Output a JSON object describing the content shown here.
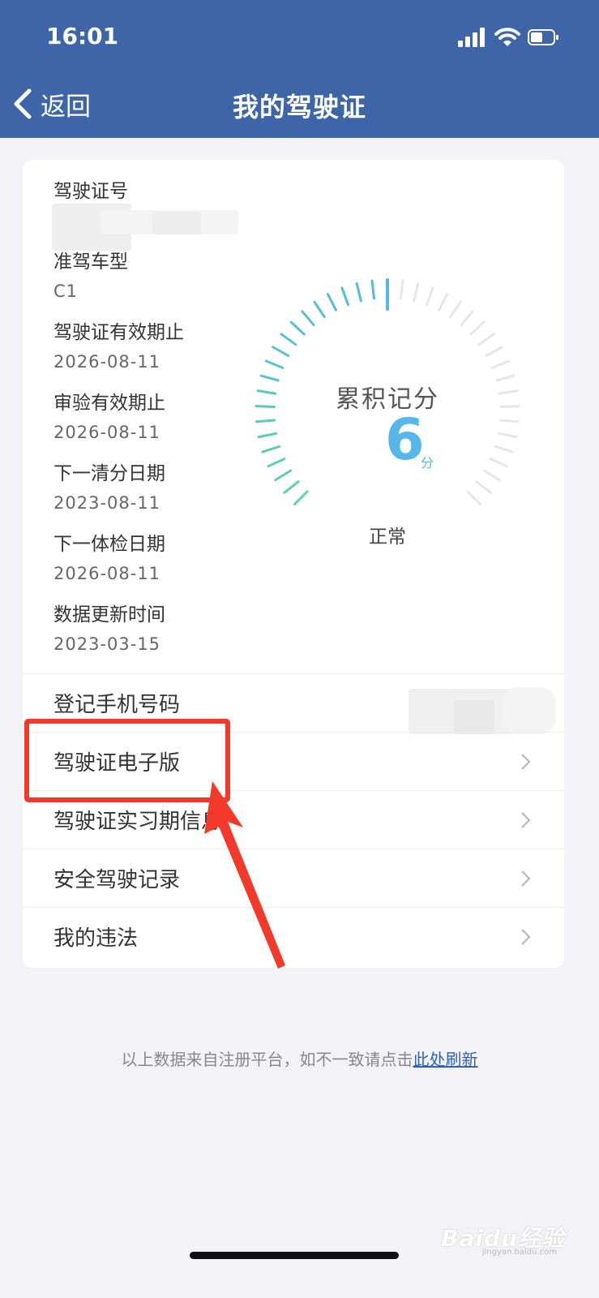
{
  "status_bar": {
    "time": "16:01"
  },
  "nav": {
    "back_label": "返回",
    "title": "我的驾驶证"
  },
  "license_info": [
    {
      "label": "驾驶证号",
      "value": ""
    },
    {
      "label": "准驾车型",
      "value": "C1"
    },
    {
      "label": "驾驶证有效期止",
      "value": "2026-08-11"
    },
    {
      "label": "审验有效期止",
      "value": "2026-08-11"
    },
    {
      "label": "下一清分日期",
      "value": "2023-08-11"
    },
    {
      "label": "下一体检日期",
      "value": "2026-08-11"
    },
    {
      "label": "数据更新时间",
      "value": "2023-03-15"
    }
  ],
  "score": {
    "title": "累积记分",
    "value": "6",
    "unit": "分",
    "status": "正常",
    "fill_fraction": 0.5,
    "color_start": "#5fd3a0",
    "color_end": "#56b7ea",
    "color_empty": "#e6e6e6"
  },
  "menu": [
    {
      "label": "登记手机号码"
    },
    {
      "label": "驾驶证电子版"
    },
    {
      "label": "驾驶证实习期信息"
    },
    {
      "label": "安全驾驶记录"
    },
    {
      "label": "我的违法"
    }
  ],
  "footer": {
    "text": "以上数据来自注册平台，如不一致请点击",
    "link": "此处刷新"
  },
  "watermark": {
    "text": "Baidu经验",
    "sub": "jingyan.baidu.com"
  },
  "colors": {
    "nav_bg": "#3d65a7",
    "page_bg": "#f2f2f7",
    "highlight": "#f33a2a",
    "link": "#2f62b3"
  }
}
